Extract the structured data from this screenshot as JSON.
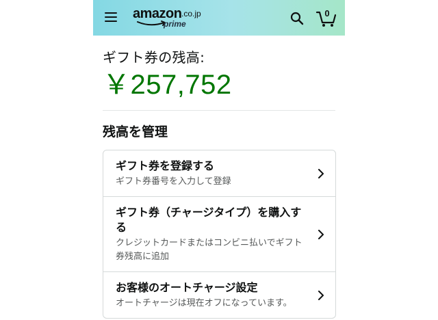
{
  "header": {
    "logo_word": "amazon",
    "logo_domain": ".co.jp",
    "logo_sub": "prime",
    "cart_count": "0",
    "icons": {
      "menu": "hamburger-menu-icon",
      "search": "search-icon",
      "cart": "cart-icon"
    },
    "gradient_colors": [
      "#84d8e3",
      "#a5e6c8"
    ]
  },
  "balance": {
    "label": "ギフト券の残高:",
    "amount": "￥257,752",
    "amount_color": "#007600"
  },
  "manage": {
    "title": "残高を管理",
    "items": [
      {
        "title": "ギフト券を登録する",
        "subtitle": "ギフト券番号を入力して登録"
      },
      {
        "title": "ギフト券（チャージタイプ）を購入する",
        "subtitle": "クレジットカードまたはコンビニ払いでギフト券残高に追加"
      },
      {
        "title": "お客様のオートチャージ設定",
        "subtitle": "オートチャージは現在オフになっています。"
      }
    ]
  }
}
